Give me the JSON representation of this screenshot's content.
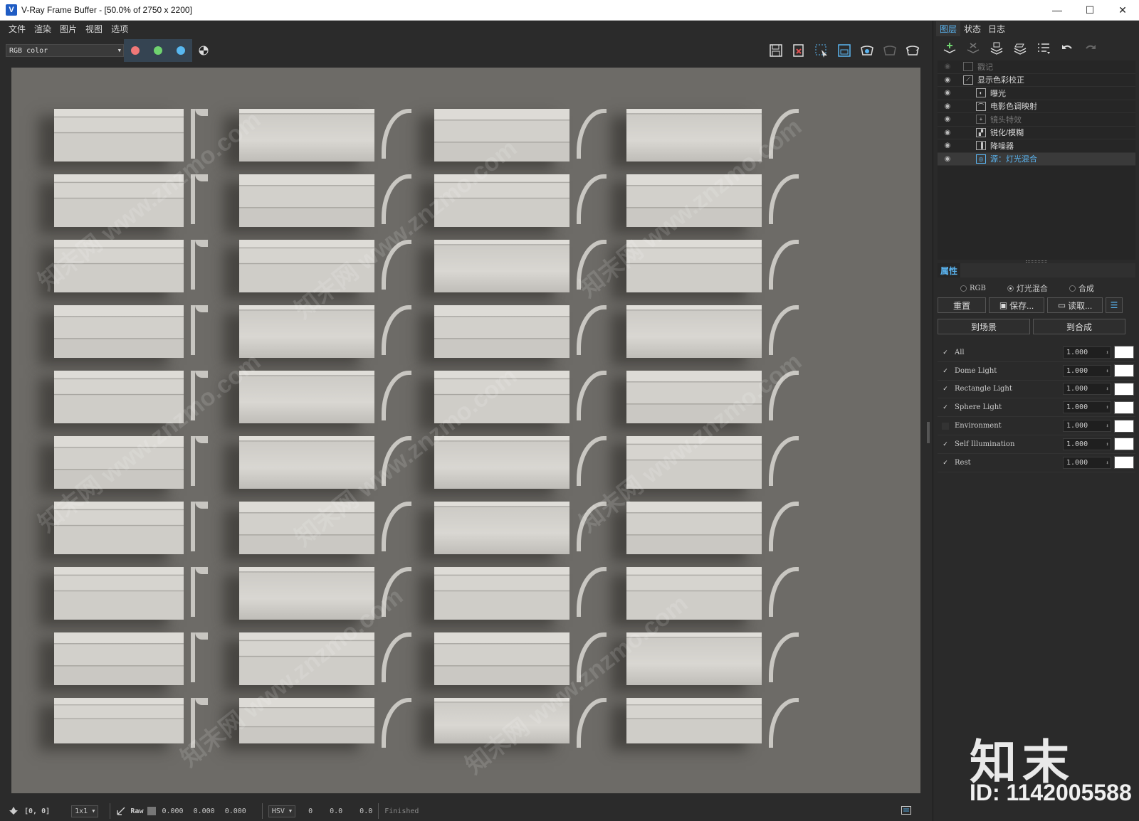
{
  "window": {
    "title": "V-Ray Frame Buffer - [50.0% of 2750 x 2200]"
  },
  "menu": [
    "文件",
    "渲染",
    "图片",
    "视图",
    "选项"
  ],
  "toolbar": {
    "channel": "RGB color",
    "colors": {
      "red": "#f07878",
      "green": "#6fd36f",
      "blue": "#58b8f0",
      "accent": "#5ab4f0"
    }
  },
  "layers_panel": {
    "tabs": [
      "图层",
      "状态",
      "日志"
    ],
    "layers": [
      {
        "label": "戳记",
        "visible": false,
        "icon": "stamp-icon",
        "dim": true
      },
      {
        "label": "显示色彩校正",
        "visible": true,
        "icon": "curve-icon"
      },
      {
        "label": "曝光",
        "visible": true,
        "icon": "exposure-icon",
        "indent": true
      },
      {
        "label": "电影色调映射",
        "visible": true,
        "icon": "tonemap-icon",
        "indent": true
      },
      {
        "label": "镜头特效",
        "visible": true,
        "icon": "lens-icon",
        "indent": true,
        "dim": true
      },
      {
        "label": "锐化/模糊",
        "visible": true,
        "icon": "sharpen-icon",
        "indent": true
      },
      {
        "label": "降噪器",
        "visible": true,
        "icon": "denoise-icon",
        "indent": true
      },
      {
        "label": "源：灯光混合",
        "visible": true,
        "icon": "source-icon",
        "indent": true,
        "selected": true
      }
    ]
  },
  "properties": {
    "header": "属性",
    "modes": [
      {
        "label": "RGB",
        "selected": false
      },
      {
        "label": "灯光混合",
        "selected": true
      },
      {
        "label": "合成",
        "selected": false
      }
    ],
    "buttons": {
      "reset": "重置",
      "save": "保存...",
      "load": "读取...",
      "to_scene": "到场景",
      "to_composite": "到合成"
    },
    "lights": [
      {
        "name": "All",
        "checked": true,
        "value": "1.000"
      },
      {
        "name": "Dome Light",
        "checked": true,
        "value": "1.000"
      },
      {
        "name": "Rectangle Light",
        "checked": true,
        "value": "1.000"
      },
      {
        "name": "Sphere Light",
        "checked": true,
        "value": "1.000"
      },
      {
        "name": "Environment",
        "checked": false,
        "value": "1.000"
      },
      {
        "name": "Self Illumination",
        "checked": true,
        "value": "1.000"
      },
      {
        "name": "Rest",
        "checked": true,
        "value": "1.000"
      }
    ]
  },
  "status": {
    "coords": "[0, 0]",
    "zoom": "1x1",
    "mode": "Raw",
    "values": [
      "0.000",
      "0.000",
      "0.000"
    ],
    "colorspace": "HSV",
    "hsv": [
      "0",
      "0.0",
      "0.0"
    ],
    "state": "Finished"
  },
  "watermark": {
    "site": "知末网 www.znzmo.com",
    "brand": "知末",
    "id": "ID: 1142005588"
  }
}
